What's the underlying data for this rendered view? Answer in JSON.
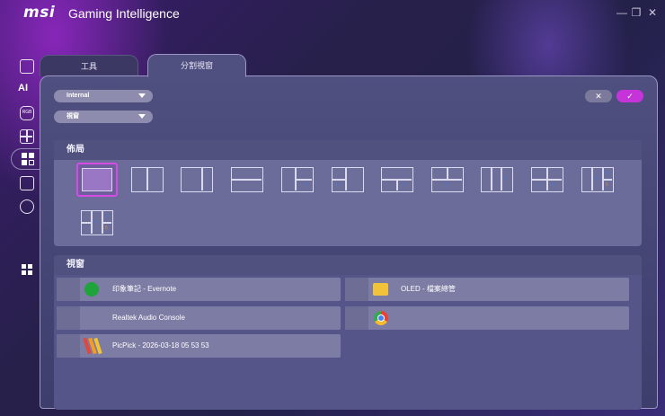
{
  "app": {
    "logo": "msi",
    "title": "Gaming Intelligence"
  },
  "window_controls": {
    "minimize": "—",
    "maximize": "❐",
    "close": "✕"
  },
  "rail": {
    "items": [
      {
        "name": "display-icon"
      },
      {
        "name": "ai-icon",
        "glyph": "AI"
      },
      {
        "name": "rgb-icon",
        "glyph": "RGB"
      },
      {
        "name": "tools-icon"
      },
      {
        "name": "split-window-icon"
      },
      {
        "name": "image-icon"
      },
      {
        "name": "network-icon"
      },
      {
        "name": "apps-icon"
      }
    ]
  },
  "tabs": [
    {
      "label": "工具"
    },
    {
      "label": "分割視窗"
    }
  ],
  "selects": {
    "display": "Internal",
    "mode": "視窗"
  },
  "actions": {
    "cancel": "✕",
    "confirm": "✓"
  },
  "sections": {
    "layout": {
      "title": "佈局"
    },
    "windows": {
      "title": "視窗"
    }
  },
  "windows": [
    {
      "name": "印象筆記 - Evernote",
      "icon": "evernote-icon"
    },
    {
      "name": "OLED - 檔案總管",
      "icon": "folder-icon"
    },
    {
      "name": "Realtek Audio Console",
      "icon": ""
    },
    {
      "name": "",
      "icon": "chrome-icon"
    },
    {
      "name": "PicPick - 2026-03-18 05 53 53",
      "icon": "picpick-icon"
    }
  ],
  "colors": {
    "accent": "#c534d9",
    "panel": "#4f4f80",
    "selected_outline": "#d44be6"
  }
}
